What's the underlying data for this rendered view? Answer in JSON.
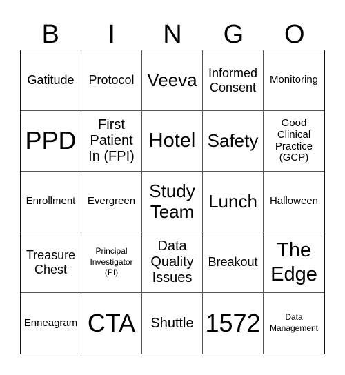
{
  "header": {
    "letters": [
      "B",
      "I",
      "N",
      "G",
      "O"
    ]
  },
  "board": {
    "rows": [
      [
        "Gatitude",
        "Protocol",
        "Veeva",
        "Informed Consent",
        "Monitoring"
      ],
      [
        "PPD",
        "First Patient In (FPI)",
        "Hotel",
        "Safety",
        "Good Clinical Practice (GCP)"
      ],
      [
        "Enrollment",
        "Evergreen",
        "Study Team",
        "Lunch",
        "Halloween"
      ],
      [
        "Treasure Chest",
        "Principal Investigator (PI)",
        "Data Quality Issues",
        "Breakout",
        "The Edge"
      ],
      [
        "Enneagram",
        "CTA",
        "Shuttle",
        "1572",
        "Data Management"
      ]
    ]
  }
}
